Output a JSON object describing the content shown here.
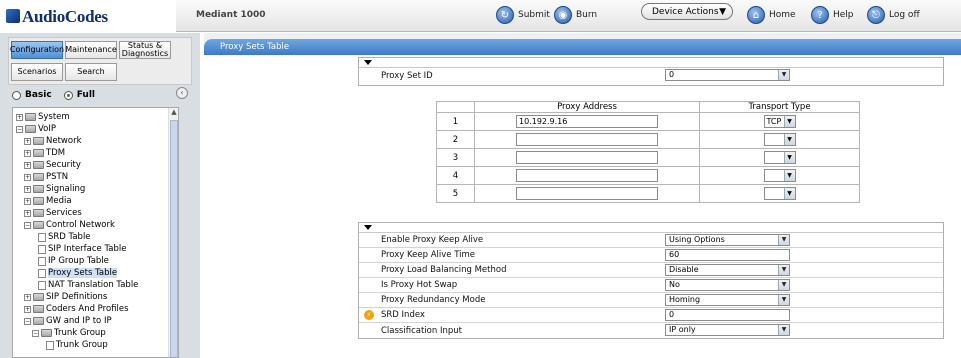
{
  "app": {
    "logo": "AudioCodes",
    "device": "Mediant 1000"
  },
  "toolbar": {
    "submit": "Submit",
    "burn": "Burn",
    "device_actions": "Device Actions",
    "home": "Home",
    "help": "Help",
    "logoff": "Log off"
  },
  "nav_tabs": {
    "configuration": "Configuration",
    "maintenance": "Maintenance",
    "status": "Status & Diagnostics",
    "scenarios": "Scenarios",
    "search": "Search"
  },
  "mode": {
    "basic": "Basic",
    "full": "Full"
  },
  "tree": [
    {
      "label": "System"
    },
    {
      "label": "VoIP"
    },
    {
      "label": "Network"
    },
    {
      "label": "TDM"
    },
    {
      "label": "Security"
    },
    {
      "label": "PSTN"
    },
    {
      "label": "Signaling"
    },
    {
      "label": "Media"
    },
    {
      "label": "Services"
    },
    {
      "label": "Control Network"
    },
    {
      "label": "SRD Table"
    },
    {
      "label": "SIP Interface Table"
    },
    {
      "label": "IP Group Table"
    },
    {
      "label": "Proxy Sets Table"
    },
    {
      "label": "NAT Translation Table"
    },
    {
      "label": "SIP Definitions"
    },
    {
      "label": "Coders And Profiles"
    },
    {
      "label": "GW and IP to IP"
    },
    {
      "label": "Trunk Group"
    },
    {
      "label": "Trunk Group"
    }
  ],
  "page_title": "Proxy Sets Table",
  "proxy_set_id": {
    "label": "Proxy Set ID",
    "value": "0"
  },
  "proxy_table": {
    "headers": {
      "address": "Proxy Address",
      "transport": "Transport Type"
    },
    "rows": [
      {
        "index": "1",
        "address": "10.192.9.16",
        "transport": "TCP"
      },
      {
        "index": "2",
        "address": "",
        "transport": ""
      },
      {
        "index": "3",
        "address": "",
        "transport": ""
      },
      {
        "index": "4",
        "address": "",
        "transport": ""
      },
      {
        "index": "5",
        "address": "",
        "transport": ""
      }
    ]
  },
  "settings": [
    {
      "label": "Enable Proxy Keep Alive",
      "value": "Using Options"
    },
    {
      "label": "Proxy Keep Alive Time",
      "value": "60"
    },
    {
      "label": "Proxy Load Balancing Method",
      "value": "Disable"
    },
    {
      "label": "Is Proxy Hot Swap",
      "value": "No"
    },
    {
      "label": "Proxy Redundancy Mode",
      "value": "Homing"
    },
    {
      "label": "SRD Index",
      "value": "0"
    },
    {
      "label": "Classification Input",
      "value": "IP only"
    }
  ]
}
